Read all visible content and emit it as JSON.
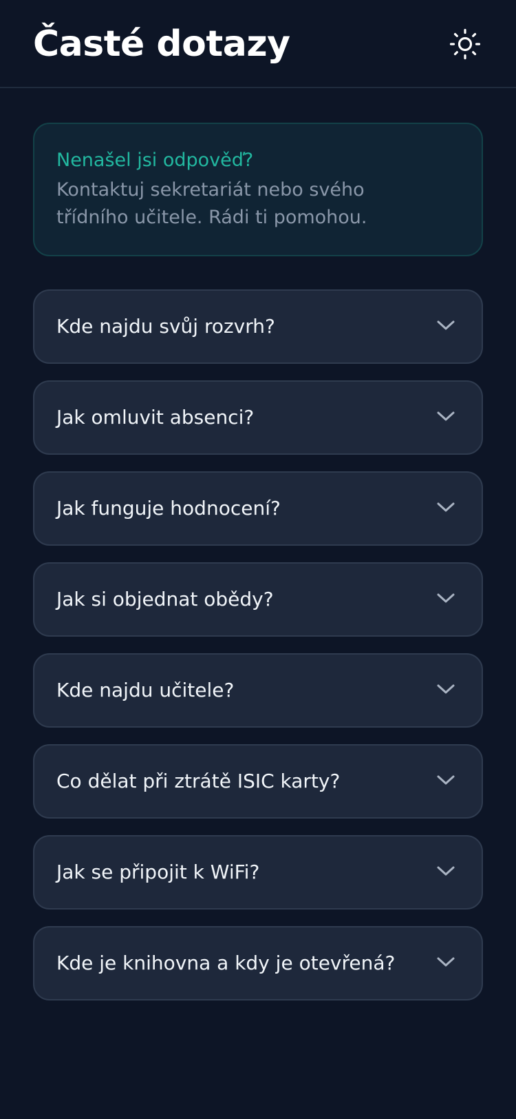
{
  "header": {
    "title": "Časté dotazy",
    "theme_icon": "sun-icon"
  },
  "info": {
    "title": "Nenašel jsi odpověď?",
    "text": "Kontaktuj sekretariát nebo svého třídního učitele. Rádi ti pomohou."
  },
  "faq": [
    {
      "question": "Kde najdu svůj rozvrh?"
    },
    {
      "question": "Jak omluvit absenci?"
    },
    {
      "question": "Jak funguje hodnocení?"
    },
    {
      "question": "Jak si objednat obědy?"
    },
    {
      "question": "Kde najdu učitele?"
    },
    {
      "question": "Co dělat při ztrátě ISIC karty?"
    },
    {
      "question": "Jak se připojit k WiFi?"
    },
    {
      "question": "Kde je knihovna a kdy je otevřená?"
    }
  ],
  "colors": {
    "background": "#0d1526",
    "card": "#1e283b",
    "accent": "#22b8a0",
    "muted_text": "#8a97a9"
  }
}
